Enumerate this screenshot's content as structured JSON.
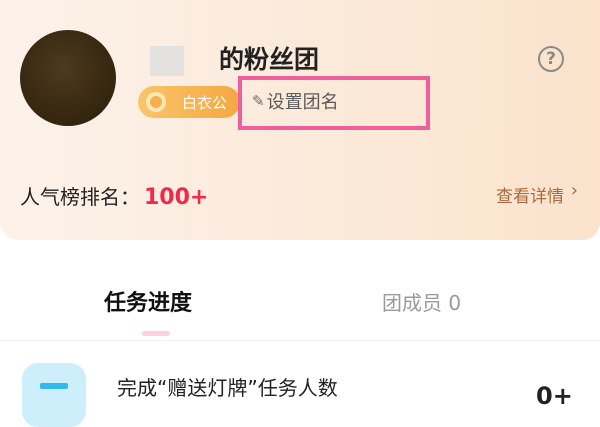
{
  "header": {
    "team_title": "的粉丝团",
    "badge_label": "白衣公",
    "set_name_label": "设置团名",
    "help_symbol": "?",
    "rank_label": "人气榜排名：",
    "rank_value": "100+",
    "detail_label": "查看详情",
    "detail_chevron": "›"
  },
  "tabs": [
    {
      "label": "任务进度",
      "selected": true
    },
    {
      "label": "团成员 0",
      "selected": false
    }
  ],
  "task": {
    "title": "完成“赠送灯牌”任务人数",
    "count": "0+"
  },
  "colors": {
    "accent_red": "#f12b47",
    "highlight_pink": "#ef5f9d",
    "badge_gold": "#f5a742",
    "detail_brown": "#aa6a3c"
  },
  "icons": {
    "help": "help-icon",
    "pencil": "pencil-icon",
    "badge": "light-badge-icon",
    "chevron": "chevron-right-icon",
    "task": "task-icon"
  }
}
